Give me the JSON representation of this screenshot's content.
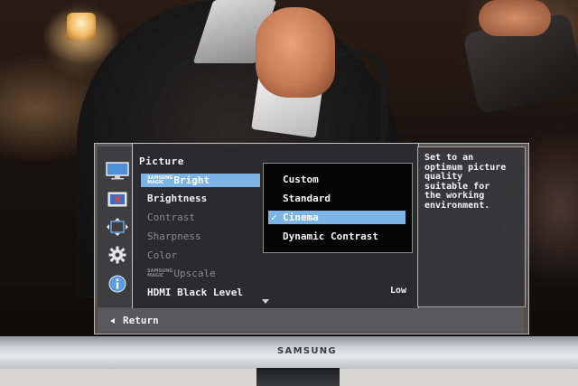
{
  "colors": {
    "highlight": "#7db4e6",
    "panel_bg": "#28282a",
    "dim_text": "#8a8a8a"
  },
  "osd": {
    "icons": [
      "monitor-picture-icon",
      "color-icon",
      "size-position-icon",
      "gear-icon",
      "info-icon"
    ],
    "menu_title": "Picture",
    "menu_items": [
      {
        "logo_top": "SAMSUNG",
        "logo_bottom": "MAGIC",
        "label": "Bright",
        "state": "selected"
      },
      {
        "label": "Brightness",
        "state": "active"
      },
      {
        "label": "Contrast",
        "state": "disabled"
      },
      {
        "label": "Sharpness",
        "state": "disabled"
      },
      {
        "label": "Color",
        "state": "disabled"
      },
      {
        "logo_top": "SAMSUNG",
        "logo_bottom": "MAGIC",
        "label": "Upscale",
        "state": "disabled"
      },
      {
        "label": "HDMI Black Level",
        "value": "Low",
        "state": "active"
      }
    ],
    "submenu": {
      "options": [
        "Custom",
        "Standard",
        "Cinema",
        "Dynamic Contrast"
      ],
      "selected": "Cinema",
      "check_glyph": "✓"
    },
    "info_text": "Set to an\noptimum picture\nquality\nsuitable for\nthe working\nenvironment.",
    "footer": {
      "return_label": "Return"
    }
  },
  "monitor": {
    "brand": "SAMSUNG"
  }
}
